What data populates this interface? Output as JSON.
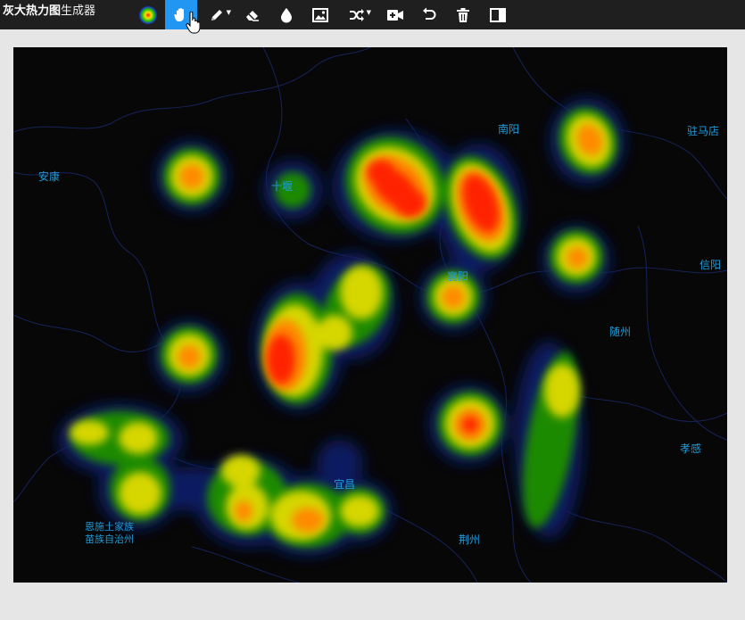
{
  "app": {
    "title_bold": "灰大热力图",
    "title_light": "生成器"
  },
  "toolbar": {
    "tools": [
      {
        "icon": "gradient-palette-icon"
      },
      {
        "icon": "hand-pan-icon",
        "active": true
      },
      {
        "icon": "pencil-icon",
        "has_dropdown": true
      },
      {
        "icon": "eraser-icon"
      },
      {
        "icon": "water-drop-icon"
      },
      {
        "icon": "image-icon"
      },
      {
        "icon": "shuffle-icon",
        "has_dropdown": true
      },
      {
        "icon": "add-video-icon"
      },
      {
        "icon": "undo-icon"
      },
      {
        "icon": "trash-icon"
      },
      {
        "icon": "split-view-icon"
      }
    ],
    "active_color": "#2196f3",
    "bg_color": "#1f1f1f"
  },
  "map": {
    "cities": {
      "ankang": "安康",
      "shiyan": "十堰",
      "nanyang": "南阳",
      "zhumadian": "驻马店",
      "xinyang": "信阳",
      "xiangyang": "襄阳",
      "suizhou": "随州",
      "xiaogan": "孝感",
      "yichang": "宜昌",
      "jingzhou": "荆州",
      "enshi_line1": "恩施土家族",
      "enshi_line2": "苗族自治州"
    },
    "label_color": "#1f9bd9",
    "background": "#070707",
    "heatmap_gradient": [
      "#0a1a55",
      "#1a6a10",
      "#cfd400",
      "#ff8800",
      "#ff1a00"
    ]
  }
}
